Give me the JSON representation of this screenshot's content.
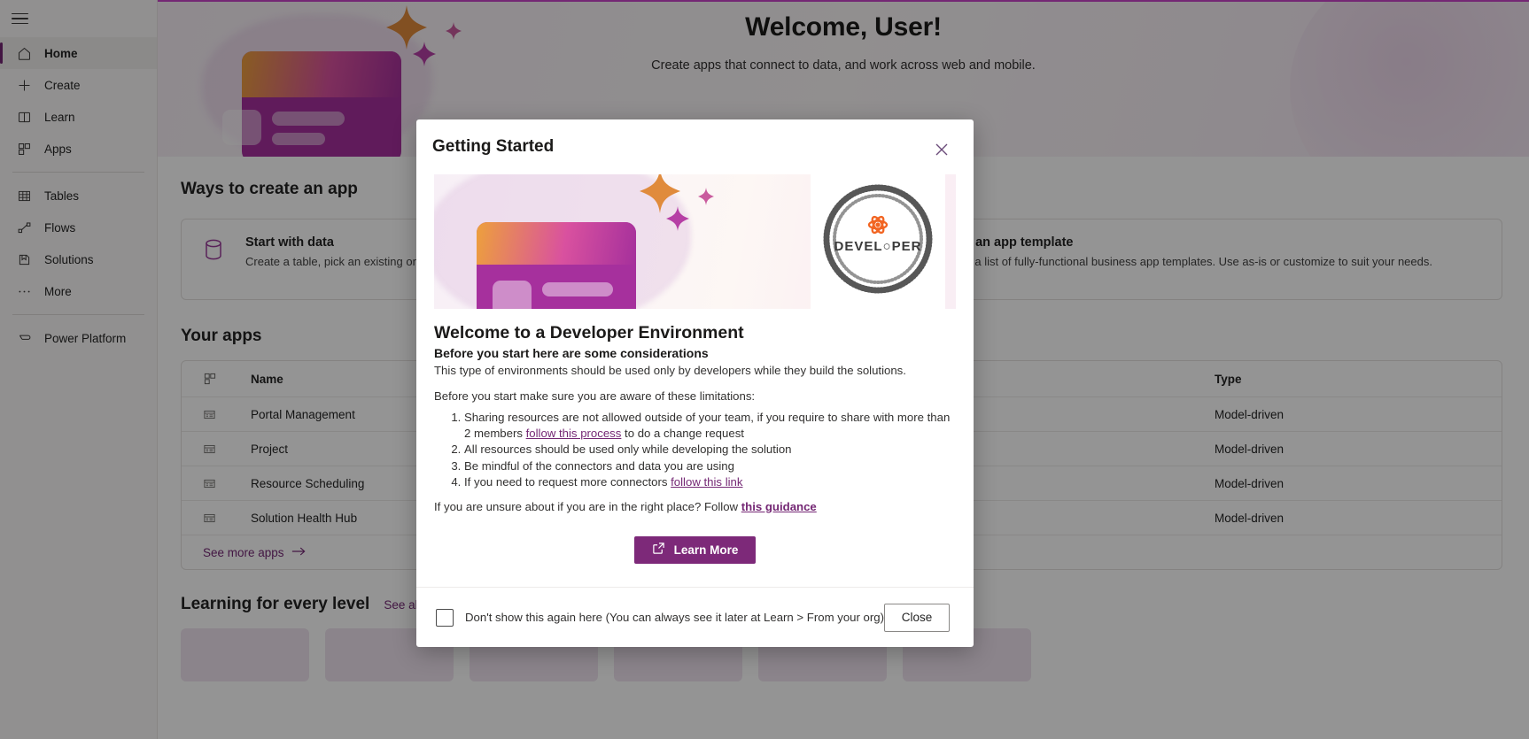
{
  "sidebar": {
    "menu_icon": "hamburger-icon",
    "items": [
      {
        "label": "Home",
        "icon": "home-icon",
        "active": true
      },
      {
        "label": "Create",
        "icon": "plus-icon",
        "active": false
      },
      {
        "label": "Learn",
        "icon": "book-icon",
        "active": false
      },
      {
        "label": "Apps",
        "icon": "apps-grid-icon",
        "active": false
      }
    ],
    "items2": [
      {
        "label": "Tables",
        "icon": "table-icon"
      },
      {
        "label": "Flows",
        "icon": "flow-icon"
      },
      {
        "label": "Solutions",
        "icon": "solutions-icon"
      },
      {
        "label": "More",
        "icon": "ellipsis-icon"
      }
    ],
    "items3": [
      {
        "label": "Power Platform",
        "icon": "power-platform-icon"
      }
    ]
  },
  "hero": {
    "title": "Welcome, User!",
    "subtitle": "Create apps that connect to data, and work across web and mobile."
  },
  "main": {
    "ways_title": "Ways to create an app",
    "cards": [
      {
        "title": "Start with data",
        "desc": "Create a table, pick an existing one, or connect from Excel to create an app.",
        "icon": "database-icon"
      },
      {
        "title": "Start with an app template",
        "desc": "Select from a list of fully-functional business app templates. Use as-is or customize to suit your needs.",
        "icon": "template-icon"
      }
    ],
    "apps_title": "Your apps",
    "table": {
      "columns": [
        "Name",
        "Type"
      ],
      "header_icon": "apps-grid-icon",
      "rows": [
        {
          "name": "Portal Management",
          "type": "Model-driven",
          "icon": "model-app-icon"
        },
        {
          "name": "Project",
          "type": "Model-driven",
          "icon": "model-app-icon"
        },
        {
          "name": "Resource Scheduling",
          "type": "Model-driven",
          "icon": "model-app-icon"
        },
        {
          "name": "Solution Health Hub",
          "type": "Model-driven",
          "icon": "model-app-icon"
        }
      ],
      "see_more": "See more apps",
      "see_more_icon": "arrow-right-icon"
    },
    "learning_title": "Learning for every level",
    "see_all": "See all"
  },
  "modal": {
    "title": "Getting Started",
    "close_icon": "close-icon",
    "banner_badge_text": "DEVEL○PER",
    "heading": "Welcome to a Developer Environment",
    "subheading": "Before you start here are some considerations",
    "intro": "This type of environments should be used only by developers while they build the solutions.",
    "limitations_intro": "Before you start make sure you are aware of these limitations:",
    "limitations": [
      {
        "pre": "Sharing resources are not allowed outside of your team, if you require to share with more than 2 members ",
        "link": "follow this process",
        "post": " to do a change request"
      },
      {
        "pre": "All resources should be used only while developing the solution",
        "link": "",
        "post": ""
      },
      {
        "pre": "Be mindful of the connectors and data you are using",
        "link": "",
        "post": ""
      },
      {
        "pre": "If you need to request more connectors ",
        "link": "follow this link",
        "post": ""
      }
    ],
    "guidance_pre": "If you are unsure about if you are in the right place? Follow ",
    "guidance_link": "this guidance",
    "learn_more_label": "Learn More",
    "learn_more_icon": "external-link-icon",
    "checkbox_label": "Don't show this again here (You can always see it later at Learn > From your org)",
    "checkbox_checked": false,
    "close_label": "Close"
  },
  "colors": {
    "accent": "#742774",
    "button": "#7d2979",
    "overlay": "rgba(0,0,0,0.42)"
  }
}
